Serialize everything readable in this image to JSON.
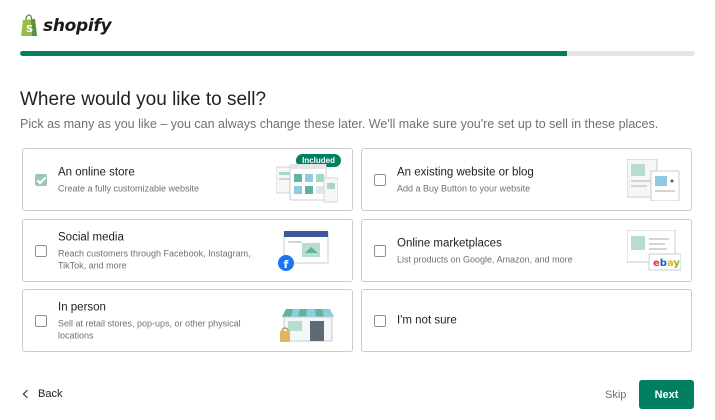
{
  "brand": {
    "name": "shopify",
    "accent": "#008060"
  },
  "progress": {
    "value": 0.81
  },
  "heading": {
    "title": "Where would you like to sell?",
    "subtitle": "Pick as many as you like – you can always change these later. We'll make sure you're set up to sell in these places."
  },
  "options": [
    {
      "title": "An online store",
      "description": "Create a fully customizable website",
      "checked": true,
      "badge": "Included",
      "icon": "online-store-illustration"
    },
    {
      "title": "An existing website or blog",
      "description": "Add a Buy Button to your website",
      "checked": false,
      "icon": "website-illustration"
    },
    {
      "title": "Social media",
      "description": "Reach customers through Facebook, Instagram, TikTok, and more",
      "checked": false,
      "icon": "facebook-illustration"
    },
    {
      "title": "Online marketplaces",
      "description": "List products on Google, Amazon, and more",
      "checked": false,
      "icon": "ebay-illustration",
      "brand_label": "ebay"
    },
    {
      "title": "In person",
      "description": "Sell at retail stores, pop-ups, or other physical locations",
      "checked": false,
      "icon": "storefront-illustration"
    },
    {
      "title": "I'm not sure",
      "description": "",
      "checked": false
    }
  ],
  "footer": {
    "back_label": "Back",
    "skip_label": "Skip",
    "next_label": "Next"
  }
}
